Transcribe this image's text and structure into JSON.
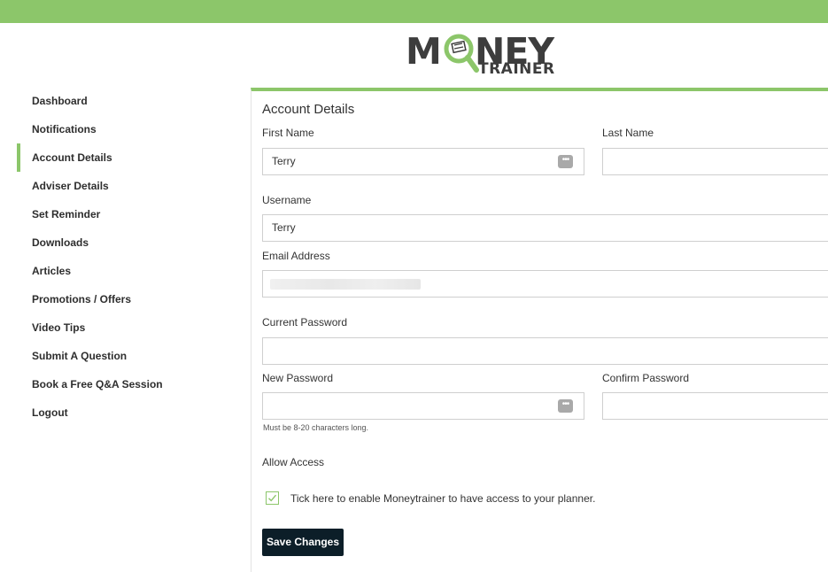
{
  "brand": {
    "logo_text_main": "MONEY",
    "logo_text_sub": "TRAINER",
    "accent_color": "#8cc66a",
    "button_color": "#0c1e28"
  },
  "sidebar": {
    "active": "Account Details",
    "items": [
      {
        "label": "Dashboard"
      },
      {
        "label": "Notifications"
      },
      {
        "label": "Account Details"
      },
      {
        "label": "Adviser Details"
      },
      {
        "label": "Set Reminder"
      },
      {
        "label": "Downloads"
      },
      {
        "label": "Articles"
      },
      {
        "label": "Promotions / Offers"
      },
      {
        "label": "Video Tips"
      },
      {
        "label": "Submit A Question"
      },
      {
        "label": "Book a Free Q&A Session"
      },
      {
        "label": "Logout"
      }
    ]
  },
  "form": {
    "title": "Account Details",
    "first_name": {
      "label": "First Name",
      "value": "Terry"
    },
    "last_name": {
      "label": "Last Name",
      "value": ""
    },
    "username": {
      "label": "Username",
      "value": "Terry"
    },
    "email": {
      "label": "Email Address",
      "value": ""
    },
    "current_password": {
      "label": "Current Password",
      "value": ""
    },
    "new_password": {
      "label": "New Password",
      "value": "",
      "hint": "Must be 8-20 characters long."
    },
    "confirm_password": {
      "label": "Confirm Password",
      "value": ""
    },
    "allow_access": {
      "label": "Allow Access",
      "checkbox_text": "Tick here to enable Moneytrainer to have access to your planner.",
      "checked": true
    },
    "save_label": "Save Changes",
    "password_icon": "ellipsis-key-icon"
  }
}
